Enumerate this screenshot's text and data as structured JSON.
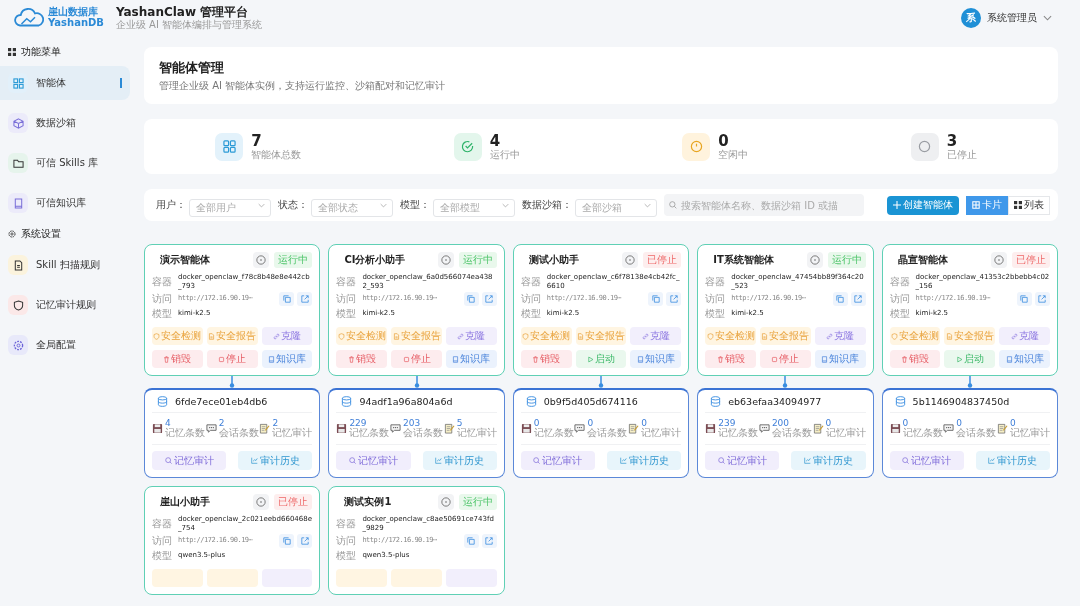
{
  "header": {
    "logo_cn": "崖山数据库",
    "logo_en": "YashanDB",
    "title": "YashanClaw 管理平台",
    "subtitle": "企业级 AI 智能体编排与管理系统",
    "user_avatar": "系",
    "user_name": "系统管理员"
  },
  "sidebar": {
    "sections": [
      {
        "title": "功能菜单",
        "kind": "grid",
        "items": [
          {
            "label": "智能体",
            "kind": "grid",
            "selected": true
          },
          {
            "label": "数据沙箱",
            "kind": "cube",
            "selected": false
          },
          {
            "label": "可信 Skills 库",
            "kind": "folder",
            "selected": false
          },
          {
            "label": "可信知识库",
            "kind": "book",
            "selected": false
          }
        ]
      },
      {
        "title": "系统设置",
        "kind": "gear",
        "items": [
          {
            "label": "Skill 扫描规则",
            "kind": "doc",
            "selected": false
          },
          {
            "label": "记忆审计规则",
            "kind": "shield",
            "selected": false
          },
          {
            "label": "全局配置",
            "kind": "gear",
            "selected": false
          }
        ]
      }
    ]
  },
  "page": {
    "title": "智能体管理",
    "description": "管理企业级 AI 智能体实例，支持运行监控、沙箱配对和记忆审计"
  },
  "stats": [
    {
      "kind": "total",
      "value": "7",
      "label": "智能体总数"
    },
    {
      "kind": "running",
      "value": "4",
      "label": "运行中"
    },
    {
      "kind": "idle",
      "value": "0",
      "label": "空闲中"
    },
    {
      "kind": "stopped",
      "value": "3",
      "label": "已停止"
    }
  ],
  "filters": [
    {
      "label": "用户：",
      "placeholder": "全部用户"
    },
    {
      "label": "状态：",
      "placeholder": "全部状态"
    },
    {
      "label": "模型：",
      "placeholder": "全部模型"
    },
    {
      "label": "数据沙箱：",
      "placeholder": "全部沙箱"
    }
  ],
  "search": {
    "placeholder": "搜索智能体名称、数据沙箱 ID 或描"
  },
  "create_button": "创建智能体",
  "views": [
    {
      "label": "卡片",
      "kind": "card",
      "selected": true
    },
    {
      "label": "列表",
      "kind": "list",
      "selected": false
    }
  ],
  "agents": [
    {
      "name": "演示智能体",
      "running": true,
      "status_text": "运行中",
      "fields": [
        {
          "kind": "container",
          "label": "容器",
          "value": "docker_openclaw_f78c8b48e8e442cb_793"
        },
        {
          "kind": "access",
          "label": "访问",
          "value": "http://172.16.90.19⋯"
        },
        {
          "kind": "model",
          "label": "模型",
          "value": "kimi-k2.5"
        }
      ],
      "actions": [
        {
          "kind": "scan",
          "label": "安全检测"
        },
        {
          "kind": "report",
          "label": "安全报告"
        },
        {
          "kind": "clone",
          "label": "克隆"
        },
        {
          "kind": "destroy",
          "label": "销毁"
        },
        {
          "kind": "stop",
          "label": "停止"
        },
        {
          "kind": "kb",
          "label": "知识库"
        }
      ],
      "sandbox": {
        "id": "6fde7ece01eb4db6",
        "metrics": [
          {
            "kind": "memory",
            "value": "4",
            "label": "记忆条数"
          },
          {
            "kind": "chat",
            "value": "2",
            "label": "会话条数"
          },
          {
            "kind": "audit",
            "value": "2",
            "label": "记忆审计"
          }
        ],
        "buttons": [
          {
            "kind": "audit",
            "label": "记忆审计"
          },
          {
            "kind": "history",
            "label": "审计历史"
          }
        ]
      }
    },
    {
      "name": "CI分析小助手",
      "running": true,
      "status_text": "运行中",
      "fields": [
        {
          "kind": "container",
          "label": "容器",
          "value": "docker_openclaw_6a0d566074ea4382_593"
        },
        {
          "kind": "access",
          "label": "访问",
          "value": "http://172.16.90.19⋯"
        },
        {
          "kind": "model",
          "label": "模型",
          "value": "kimi-k2.5"
        }
      ],
      "actions": [
        {
          "kind": "scan",
          "label": "安全检测"
        },
        {
          "kind": "report",
          "label": "安全报告"
        },
        {
          "kind": "clone",
          "label": "克隆"
        },
        {
          "kind": "destroy",
          "label": "销毁"
        },
        {
          "kind": "stop",
          "label": "停止"
        },
        {
          "kind": "kb",
          "label": "知识库"
        }
      ],
      "sandbox": {
        "id": "94adf1a96a804a6d",
        "metrics": [
          {
            "kind": "memory",
            "value": "229",
            "label": "记忆条数"
          },
          {
            "kind": "chat",
            "value": "203",
            "label": "会话条数"
          },
          {
            "kind": "audit",
            "value": "5",
            "label": "记忆审计"
          }
        ],
        "buttons": [
          {
            "kind": "audit",
            "label": "记忆审计"
          },
          {
            "kind": "history",
            "label": "审计历史"
          }
        ]
      }
    },
    {
      "name": "测试小助手",
      "running": false,
      "status_text": "已停止",
      "fields": [
        {
          "kind": "container",
          "label": "容器",
          "value": "docker_openclaw_c6f78138e4cb42fc_6610"
        },
        {
          "kind": "access",
          "label": "访问",
          "value": "http://172.16.90.19⋯"
        },
        {
          "kind": "model",
          "label": "模型",
          "value": "kimi-k2.5"
        }
      ],
      "actions": [
        {
          "kind": "scan",
          "label": "安全检测"
        },
        {
          "kind": "report",
          "label": "安全报告"
        },
        {
          "kind": "clone",
          "label": "克隆"
        },
        {
          "kind": "destroy",
          "label": "销毁"
        },
        {
          "kind": "start",
          "label": "启动"
        },
        {
          "kind": "kb",
          "label": "知识库"
        }
      ],
      "sandbox": {
        "id": "0b9f5d405d674116",
        "metrics": [
          {
            "kind": "memory",
            "value": "0",
            "label": "记忆条数"
          },
          {
            "kind": "chat",
            "value": "0",
            "label": "会话条数"
          },
          {
            "kind": "audit",
            "value": "0",
            "label": "记忆审计"
          }
        ],
        "buttons": [
          {
            "kind": "audit",
            "label": "记忆审计"
          },
          {
            "kind": "history",
            "label": "审计历史"
          }
        ]
      }
    },
    {
      "name": "IT系统智能体",
      "running": true,
      "status_text": "运行中",
      "fields": [
        {
          "kind": "container",
          "label": "容器",
          "value": "docker_openclaw_47454bb89f364c20_523"
        },
        {
          "kind": "access",
          "label": "访问",
          "value": "http://172.16.90.19⋯"
        },
        {
          "kind": "model",
          "label": "模型",
          "value": "kimi-k2.5"
        }
      ],
      "actions": [
        {
          "kind": "scan",
          "label": "安全检测"
        },
        {
          "kind": "report",
          "label": "安全报告"
        },
        {
          "kind": "clone",
          "label": "克隆"
        },
        {
          "kind": "destroy",
          "label": "销毁"
        },
        {
          "kind": "stop",
          "label": "停止"
        },
        {
          "kind": "kb",
          "label": "知识库"
        }
      ],
      "sandbox": {
        "id": "eb63efaa34094977",
        "metrics": [
          {
            "kind": "memory",
            "value": "239",
            "label": "记忆条数"
          },
          {
            "kind": "chat",
            "value": "200",
            "label": "会话条数"
          },
          {
            "kind": "audit",
            "value": "0",
            "label": "记忆审计"
          }
        ],
        "buttons": [
          {
            "kind": "audit",
            "label": "记忆审计"
          },
          {
            "kind": "history",
            "label": "审计历史"
          }
        ]
      }
    },
    {
      "name": "晶宣智能体",
      "running": false,
      "status_text": "已停止",
      "fields": [
        {
          "kind": "container",
          "label": "容器",
          "value": "docker_openclaw_41353c2bbebb4c02_156"
        },
        {
          "kind": "access",
          "label": "访问",
          "value": "http://172.16.90.19⋯"
        },
        {
          "kind": "model",
          "label": "模型",
          "value": "kimi-k2.5"
        }
      ],
      "actions": [
        {
          "kind": "scan",
          "label": "安全检测"
        },
        {
          "kind": "report",
          "label": "安全报告"
        },
        {
          "kind": "clone",
          "label": "克隆"
        },
        {
          "kind": "destroy",
          "label": "销毁"
        },
        {
          "kind": "start",
          "label": "启动"
        },
        {
          "kind": "kb",
          "label": "知识库"
        }
      ],
      "sandbox": {
        "id": "5b1146904837450d",
        "metrics": [
          {
            "kind": "memory",
            "value": "0",
            "label": "记忆条数"
          },
          {
            "kind": "chat",
            "value": "0",
            "label": "会话条数"
          },
          {
            "kind": "audit",
            "value": "0",
            "label": "记忆审计"
          }
        ],
        "buttons": [
          {
            "kind": "audit",
            "label": "记忆审计"
          },
          {
            "kind": "history",
            "label": "审计历史"
          }
        ]
      }
    },
    {
      "name": "崖山小助手",
      "running": false,
      "status_text": "已停止",
      "fields": [
        {
          "kind": "container",
          "label": "容器",
          "value": "docker_openclaw_2c021eebd660468e_754"
        },
        {
          "kind": "access",
          "label": "访问",
          "value": "http://172.16.90.19⋯"
        },
        {
          "kind": "model",
          "label": "模型",
          "value": "qwen3.5-plus"
        }
      ],
      "actions": [
        {
          "kind": "scan"
        },
        {
          "kind": "report"
        },
        {
          "kind": "clone"
        }
      ]
    },
    {
      "name": "测试实例1",
      "running": true,
      "status_text": "运行中",
      "fields": [
        {
          "kind": "container",
          "label": "容器",
          "value": "docker_openclaw_c8ae50691ce743fd_9829"
        },
        {
          "kind": "access",
          "label": "访问",
          "value": "http://172.16.90.19⋯"
        },
        {
          "kind": "model",
          "label": "模型",
          "value": "qwen3.5-plus"
        }
      ],
      "actions": [
        {
          "kind": "scan"
        },
        {
          "kind": "report"
        },
        {
          "kind": "clone"
        }
      ]
    }
  ]
}
